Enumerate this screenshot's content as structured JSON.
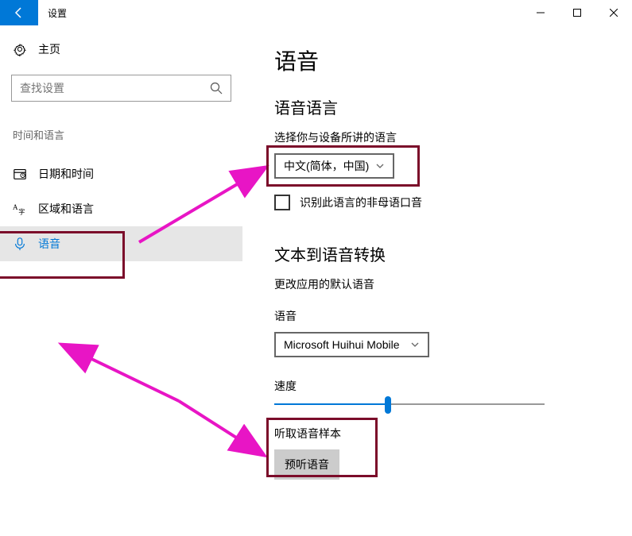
{
  "titlebar": {
    "title": "设置"
  },
  "sidebar": {
    "home_label": "主页",
    "search_placeholder": "查找设置",
    "category": "时间和语言",
    "items": [
      {
        "label": "日期和时间",
        "icon": "clock"
      },
      {
        "label": "区域和语言",
        "icon": "language"
      },
      {
        "label": "语音",
        "icon": "mic"
      }
    ]
  },
  "main": {
    "page_title": "语音",
    "speech_lang": {
      "section": "语音语言",
      "label": "选择你与设备所讲的语言",
      "value": "中文(简体，中国)",
      "checkbox_label": "识别此语言的非母语口音"
    },
    "tts": {
      "section": "文本到语音转换",
      "desc": "更改应用的默认语音",
      "voice_label": "语音",
      "voice_value": "Microsoft Huihui Mobile",
      "speed_label": "速度",
      "sample_label": "听取语音样本",
      "preview_btn": "预听语音"
    }
  }
}
